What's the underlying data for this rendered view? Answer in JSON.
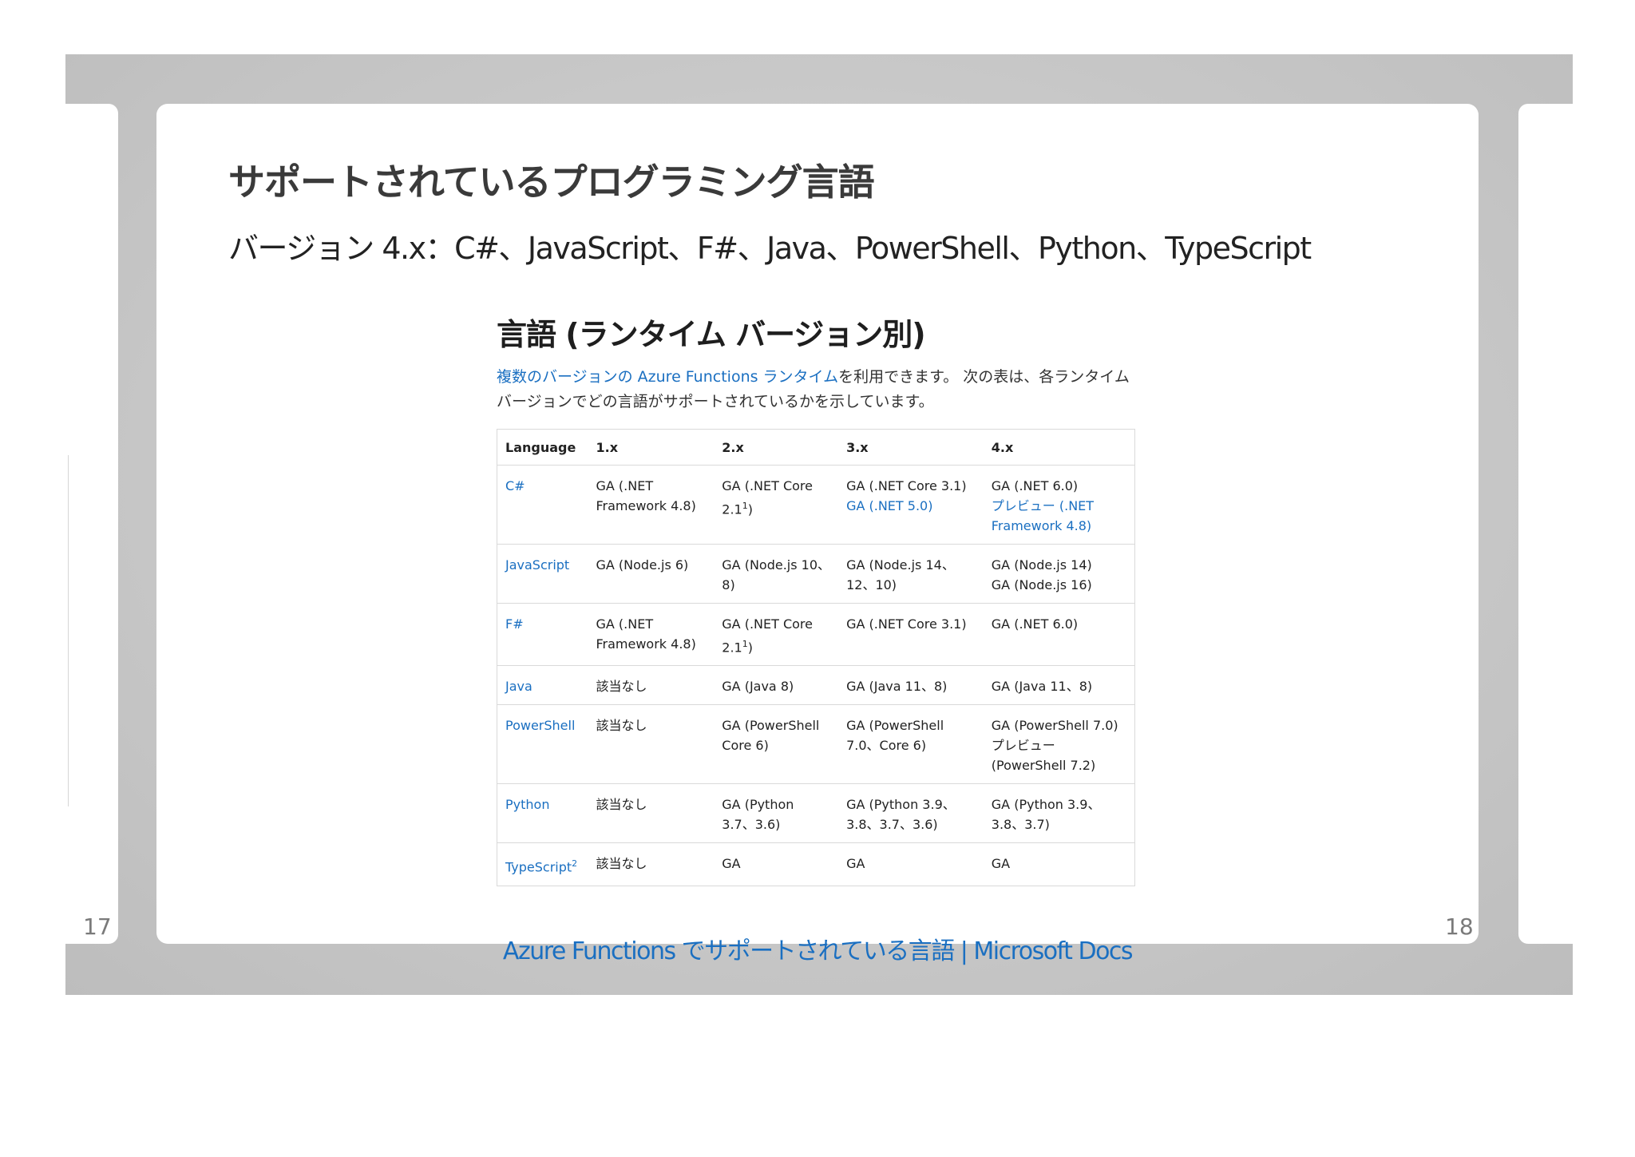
{
  "prev_slide": {
    "number": "17"
  },
  "next_slide": {
    "number": "18"
  },
  "slide": {
    "title": "サポートされているプログラミング言語",
    "subtitle": "バージョン 4.x：C#、JavaScript、F#、Java、PowerShell、Python、TypeScript",
    "doc": {
      "heading": "言語 (ランタイム バージョン別)",
      "intro_link": "複数のバージョンの Azure Functions ランタイム",
      "intro_text": "を利用できます。 次の表は、各ランタイム バージョンでどの言語がサポートされているかを示しています。",
      "table": {
        "headers": [
          "Language",
          "1.x",
          "2.x",
          "3.x",
          "4.x"
        ],
        "rows": [
          {
            "language": "C#",
            "v1": "GA (.NET Framework 4.8)",
            "v2": "GA (.NET Core 2.1",
            "v2_sup": "1",
            "v2_end": ")",
            "v3": "GA (.NET Core 3.1)",
            "v3b": "GA (.NET 5.0)",
            "v4": "GA (.NET 6.0)",
            "v4b": "プレビュー (.NET Framework 4.8)"
          },
          {
            "language": "JavaScript",
            "v1": "GA (Node.js 6)",
            "v2": "GA (Node.js 10、8)",
            "v3": "GA (Node.js 14、12、10)",
            "v4": "GA (Node.js 14)",
            "v4b": "GA (Node.js 16)"
          },
          {
            "language": "F#",
            "v1": "GA (.NET Framework 4.8)",
            "v2": "GA (.NET Core 2.1",
            "v2_sup": "1",
            "v2_end": ")",
            "v3": "GA (.NET Core 3.1)",
            "v4": "GA (.NET 6.0)"
          },
          {
            "language": "Java",
            "v1": "該当なし",
            "v2": "GA (Java 8)",
            "v3": "GA (Java 11、8)",
            "v4": "GA (Java 11、8)"
          },
          {
            "language": "PowerShell",
            "v1": "該当なし",
            "v2": "GA (PowerShell Core 6)",
            "v3": "GA (PowerShell 7.0、Core 6)",
            "v4": "GA (PowerShell 7.0)",
            "v4b": "プレビュー (PowerShell 7.2)"
          },
          {
            "language": "Python",
            "v1": "該当なし",
            "v2": "GA (Python 3.7、3.6)",
            "v3": "GA (Python 3.9、3.8、3.7、3.6)",
            "v4": "GA (Python 3.9、3.8、3.7)"
          },
          {
            "language": "TypeScript",
            "language_sup": "2",
            "v1": "該当なし",
            "v2": "GA",
            "v3": "GA",
            "v4": "GA"
          }
        ]
      }
    },
    "link": "Azure Functions でサポートされている言語 | Microsoft Docs"
  },
  "colors": {
    "link": "#1a6fc1",
    "backdrop": "#c8c8c8",
    "slide": "#ffffff"
  }
}
